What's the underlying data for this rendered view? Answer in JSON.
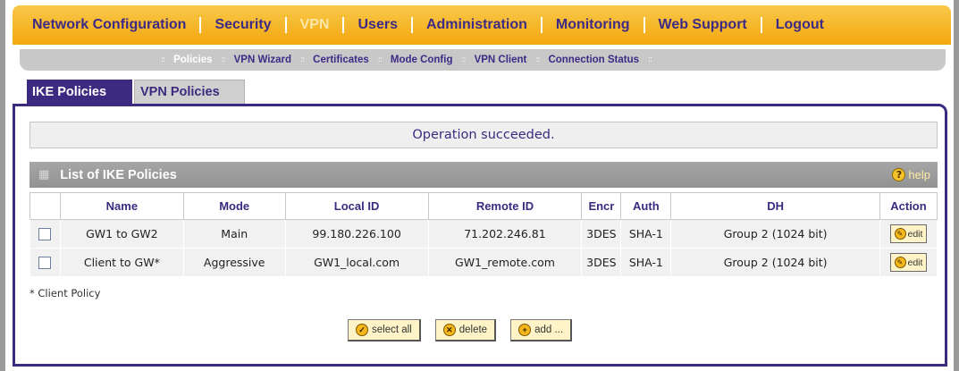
{
  "nav": {
    "items": [
      {
        "label": "Network Configuration",
        "active": false
      },
      {
        "label": "Security",
        "active": false
      },
      {
        "label": "VPN",
        "active": true
      },
      {
        "label": "Users",
        "active": false
      },
      {
        "label": "Administration",
        "active": false
      },
      {
        "label": "Monitoring",
        "active": false
      },
      {
        "label": "Web Support",
        "active": false
      },
      {
        "label": "Logout",
        "active": false
      }
    ]
  },
  "subnav": {
    "items": [
      {
        "label": "Policies",
        "active": true
      },
      {
        "label": "VPN Wizard",
        "active": false
      },
      {
        "label": "Certificates",
        "active": false
      },
      {
        "label": "Mode Config",
        "active": false
      },
      {
        "label": "VPN Client",
        "active": false
      },
      {
        "label": "Connection Status",
        "active": false
      }
    ]
  },
  "tabs": [
    {
      "label": "IKE Policies",
      "active": true
    },
    {
      "label": "VPN Policies",
      "active": false
    }
  ],
  "status_message": "Operation succeeded.",
  "section": {
    "title": "List of IKE Policies",
    "help_label": "help"
  },
  "table": {
    "headers": [
      "",
      "Name",
      "Mode",
      "Local ID",
      "Remote ID",
      "Encr",
      "Auth",
      "DH",
      "Action"
    ],
    "rows": [
      {
        "name": "GW1 to GW2",
        "mode": "Main",
        "local_id": "99.180.226.100",
        "remote_id": "71.202.246.81",
        "encr": "3DES",
        "auth": "SHA-1",
        "dh": "Group 2 (1024 bit)",
        "action": "edit"
      },
      {
        "name": "Client to GW*",
        "mode": "Aggressive",
        "local_id": "GW1_local.com",
        "remote_id": "GW1_remote.com",
        "encr": "3DES",
        "auth": "SHA-1",
        "dh": "Group 2 (1024 bit)",
        "action": "edit"
      }
    ]
  },
  "footnote": "* Client Policy",
  "buttons": {
    "select_all": "select all",
    "delete": "delete",
    "add": "add ..."
  },
  "colors": {
    "nav_bg": "#f3a80e",
    "brand_purple": "#3c2a80",
    "subnav_bg": "#c8c8c8"
  }
}
